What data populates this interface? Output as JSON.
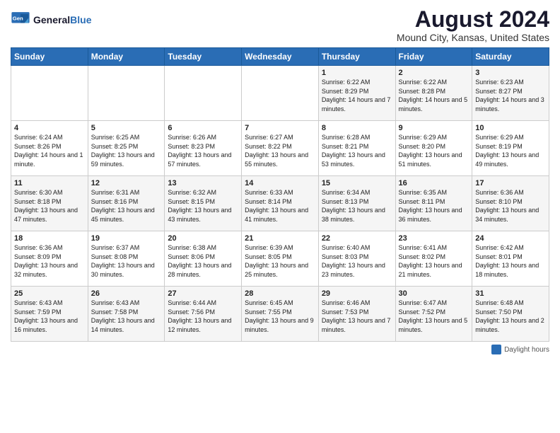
{
  "header": {
    "logo_line1": "General",
    "logo_line2": "Blue",
    "title": "August 2024",
    "subtitle": "Mound City, Kansas, United States"
  },
  "weekdays": [
    "Sunday",
    "Monday",
    "Tuesday",
    "Wednesday",
    "Thursday",
    "Friday",
    "Saturday"
  ],
  "weeks": [
    [
      {
        "day": "",
        "sunrise": "",
        "sunset": "",
        "daylight": ""
      },
      {
        "day": "",
        "sunrise": "",
        "sunset": "",
        "daylight": ""
      },
      {
        "day": "",
        "sunrise": "",
        "sunset": "",
        "daylight": ""
      },
      {
        "day": "",
        "sunrise": "",
        "sunset": "",
        "daylight": ""
      },
      {
        "day": "1",
        "sunrise": "Sunrise: 6:22 AM",
        "sunset": "Sunset: 8:29 PM",
        "daylight": "Daylight: 14 hours and 7 minutes."
      },
      {
        "day": "2",
        "sunrise": "Sunrise: 6:22 AM",
        "sunset": "Sunset: 8:28 PM",
        "daylight": "Daylight: 14 hours and 5 minutes."
      },
      {
        "day": "3",
        "sunrise": "Sunrise: 6:23 AM",
        "sunset": "Sunset: 8:27 PM",
        "daylight": "Daylight: 14 hours and 3 minutes."
      }
    ],
    [
      {
        "day": "4",
        "sunrise": "Sunrise: 6:24 AM",
        "sunset": "Sunset: 8:26 PM",
        "daylight": "Daylight: 14 hours and 1 minute."
      },
      {
        "day": "5",
        "sunrise": "Sunrise: 6:25 AM",
        "sunset": "Sunset: 8:25 PM",
        "daylight": "Daylight: 13 hours and 59 minutes."
      },
      {
        "day": "6",
        "sunrise": "Sunrise: 6:26 AM",
        "sunset": "Sunset: 8:23 PM",
        "daylight": "Daylight: 13 hours and 57 minutes."
      },
      {
        "day": "7",
        "sunrise": "Sunrise: 6:27 AM",
        "sunset": "Sunset: 8:22 PM",
        "daylight": "Daylight: 13 hours and 55 minutes."
      },
      {
        "day": "8",
        "sunrise": "Sunrise: 6:28 AM",
        "sunset": "Sunset: 8:21 PM",
        "daylight": "Daylight: 13 hours and 53 minutes."
      },
      {
        "day": "9",
        "sunrise": "Sunrise: 6:29 AM",
        "sunset": "Sunset: 8:20 PM",
        "daylight": "Daylight: 13 hours and 51 minutes."
      },
      {
        "day": "10",
        "sunrise": "Sunrise: 6:29 AM",
        "sunset": "Sunset: 8:19 PM",
        "daylight": "Daylight: 13 hours and 49 minutes."
      }
    ],
    [
      {
        "day": "11",
        "sunrise": "Sunrise: 6:30 AM",
        "sunset": "Sunset: 8:18 PM",
        "daylight": "Daylight: 13 hours and 47 minutes."
      },
      {
        "day": "12",
        "sunrise": "Sunrise: 6:31 AM",
        "sunset": "Sunset: 8:16 PM",
        "daylight": "Daylight: 13 hours and 45 minutes."
      },
      {
        "day": "13",
        "sunrise": "Sunrise: 6:32 AM",
        "sunset": "Sunset: 8:15 PM",
        "daylight": "Daylight: 13 hours and 43 minutes."
      },
      {
        "day": "14",
        "sunrise": "Sunrise: 6:33 AM",
        "sunset": "Sunset: 8:14 PM",
        "daylight": "Daylight: 13 hours and 41 minutes."
      },
      {
        "day": "15",
        "sunrise": "Sunrise: 6:34 AM",
        "sunset": "Sunset: 8:13 PM",
        "daylight": "Daylight: 13 hours and 38 minutes."
      },
      {
        "day": "16",
        "sunrise": "Sunrise: 6:35 AM",
        "sunset": "Sunset: 8:11 PM",
        "daylight": "Daylight: 13 hours and 36 minutes."
      },
      {
        "day": "17",
        "sunrise": "Sunrise: 6:36 AM",
        "sunset": "Sunset: 8:10 PM",
        "daylight": "Daylight: 13 hours and 34 minutes."
      }
    ],
    [
      {
        "day": "18",
        "sunrise": "Sunrise: 6:36 AM",
        "sunset": "Sunset: 8:09 PM",
        "daylight": "Daylight: 13 hours and 32 minutes."
      },
      {
        "day": "19",
        "sunrise": "Sunrise: 6:37 AM",
        "sunset": "Sunset: 8:08 PM",
        "daylight": "Daylight: 13 hours and 30 minutes."
      },
      {
        "day": "20",
        "sunrise": "Sunrise: 6:38 AM",
        "sunset": "Sunset: 8:06 PM",
        "daylight": "Daylight: 13 hours and 28 minutes."
      },
      {
        "day": "21",
        "sunrise": "Sunrise: 6:39 AM",
        "sunset": "Sunset: 8:05 PM",
        "daylight": "Daylight: 13 hours and 25 minutes."
      },
      {
        "day": "22",
        "sunrise": "Sunrise: 6:40 AM",
        "sunset": "Sunset: 8:03 PM",
        "daylight": "Daylight: 13 hours and 23 minutes."
      },
      {
        "day": "23",
        "sunrise": "Sunrise: 6:41 AM",
        "sunset": "Sunset: 8:02 PM",
        "daylight": "Daylight: 13 hours and 21 minutes."
      },
      {
        "day": "24",
        "sunrise": "Sunrise: 6:42 AM",
        "sunset": "Sunset: 8:01 PM",
        "daylight": "Daylight: 13 hours and 18 minutes."
      }
    ],
    [
      {
        "day": "25",
        "sunrise": "Sunrise: 6:43 AM",
        "sunset": "Sunset: 7:59 PM",
        "daylight": "Daylight: 13 hours and 16 minutes."
      },
      {
        "day": "26",
        "sunrise": "Sunrise: 6:43 AM",
        "sunset": "Sunset: 7:58 PM",
        "daylight": "Daylight: 13 hours and 14 minutes."
      },
      {
        "day": "27",
        "sunrise": "Sunrise: 6:44 AM",
        "sunset": "Sunset: 7:56 PM",
        "daylight": "Daylight: 13 hours and 12 minutes."
      },
      {
        "day": "28",
        "sunrise": "Sunrise: 6:45 AM",
        "sunset": "Sunset: 7:55 PM",
        "daylight": "Daylight: 13 hours and 9 minutes."
      },
      {
        "day": "29",
        "sunrise": "Sunrise: 6:46 AM",
        "sunset": "Sunset: 7:53 PM",
        "daylight": "Daylight: 13 hours and 7 minutes."
      },
      {
        "day": "30",
        "sunrise": "Sunrise: 6:47 AM",
        "sunset": "Sunset: 7:52 PM",
        "daylight": "Daylight: 13 hours and 5 minutes."
      },
      {
        "day": "31",
        "sunrise": "Sunrise: 6:48 AM",
        "sunset": "Sunset: 7:50 PM",
        "daylight": "Daylight: 13 hours and 2 minutes."
      }
    ]
  ],
  "footer": {
    "legend_label": "Daylight hours"
  }
}
